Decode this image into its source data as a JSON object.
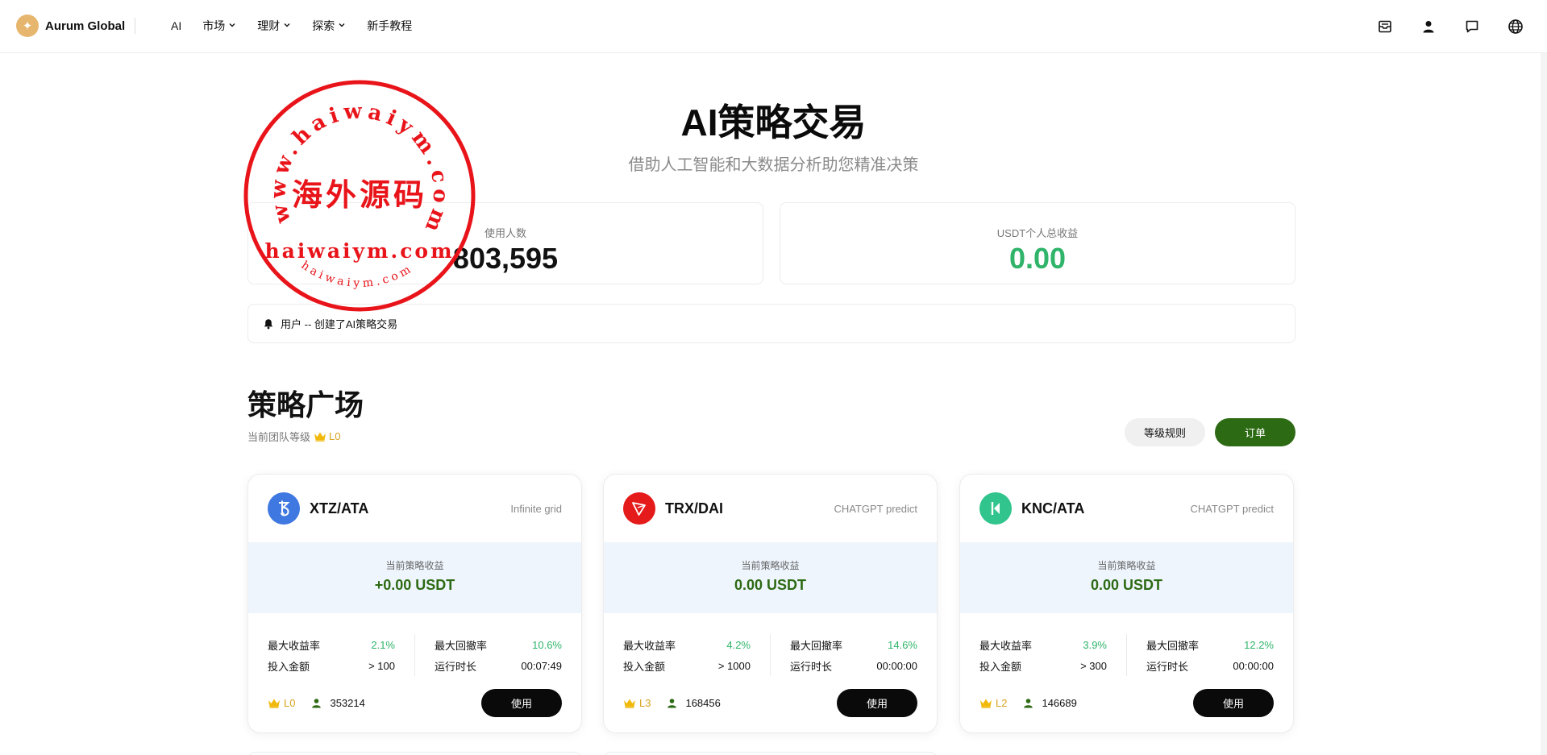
{
  "header": {
    "brand": "Aurum Global",
    "nav": [
      {
        "label": "AI",
        "has_dropdown": false
      },
      {
        "label": "市场",
        "has_dropdown": true
      },
      {
        "label": "理财",
        "has_dropdown": true
      },
      {
        "label": "探索",
        "has_dropdown": true
      },
      {
        "label": "新手教程",
        "has_dropdown": false
      }
    ],
    "icons": [
      "inbox-icon",
      "user-icon",
      "message-icon",
      "globe-icon"
    ]
  },
  "hero": {
    "title": "AI策略交易",
    "subtitle": "借助人工智能和大数据分析助您精准决策"
  },
  "stats": {
    "users_label": "使用人数",
    "users_value": "803,595",
    "profit_label": "USDT个人总收益",
    "profit_value": "0.00"
  },
  "notice": {
    "text": "用户 -- 创建了AI策略交易"
  },
  "square": {
    "title": "策略广场",
    "level_label": "当前团队等级",
    "level_value": "L0",
    "rules_button": "等级规则",
    "orders_button": "订单"
  },
  "cards": [
    {
      "pair": "XTZ/ATA",
      "type": "Infinite grid",
      "coin_color": "#3f78e0",
      "coin_icon": "tezos-icon",
      "profit_label": "当前策略收益",
      "profit": "+0.00 USDT",
      "max_yield_label": "最大收益率",
      "max_yield": "2.1%",
      "max_drawdown_label": "最大回撤率",
      "max_drawdown": "10.6%",
      "amount_label": "投入金额",
      "amount": "> 100",
      "runtime_label": "运行时长",
      "runtime": "00:07:49",
      "level": "L0",
      "users": "353214",
      "use_button": "使用"
    },
    {
      "pair": "TRX/DAI",
      "type": "CHATGPT predict",
      "coin_color": "#e51a1a",
      "coin_icon": "tron-icon",
      "profit_label": "当前策略收益",
      "profit": "0.00 USDT",
      "max_yield_label": "最大收益率",
      "max_yield": "4.2%",
      "max_drawdown_label": "最大回撤率",
      "max_drawdown": "14.6%",
      "amount_label": "投入金额",
      "amount": "> 1000",
      "runtime_label": "运行时长",
      "runtime": "00:00:00",
      "level": "L3",
      "users": "168456",
      "use_button": "使用"
    },
    {
      "pair": "KNC/ATA",
      "type": "CHATGPT predict",
      "coin_color": "#31c48d",
      "coin_icon": "kyber-icon",
      "profit_label": "当前策略收益",
      "profit": "0.00 USDT",
      "max_yield_label": "最大收益率",
      "max_yield": "3.9%",
      "max_drawdown_label": "最大回撤率",
      "max_drawdown": "12.2%",
      "amount_label": "投入金额",
      "amount": "> 300",
      "runtime_label": "运行时长",
      "runtime": "00:00:00",
      "level": "L2",
      "users": "146689",
      "use_button": "使用"
    }
  ],
  "watermark": {
    "ring_text": "www.haiwaiym.com",
    "center_text": "海外源码",
    "domain_text": "haiwaiym.com",
    "small_text": "haiwaiym.com",
    "color": "#e8141a"
  }
}
